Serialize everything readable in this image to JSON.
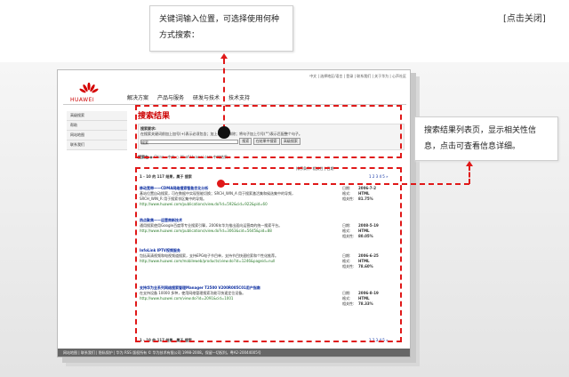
{
  "close_label": "[点击关闭]",
  "callouts": {
    "input": "关键词输入位置，可选择使用何种方式搜索：",
    "results": "搜索结果列表页，显示相关性信息，点击可查看信息详细。"
  },
  "brand": "HUAWEI",
  "toplinks": "中文 | 选择地区/语言 | 登录 | 联系我们 | 关于华为 | 心声社区",
  "nav": [
    "解决方案",
    "产品与服务",
    "研发与技术",
    "技术支持"
  ],
  "sidebar": [
    "高级搜索",
    "帮助",
    "网站地图",
    "联系我们"
  ],
  "page_title": "搜索结果",
  "search": {
    "label": "搜索要求:",
    "hint": "在搜索关键词前加上加号(+)表示必须包含；加上(-)表示排除；将句子加上引号(\"\")表示匹配整个句子。",
    "value": "搜索",
    "btn_search": "搜索",
    "btn_within": "在结果中搜索",
    "btn_advanced": "高级搜索",
    "scope_label": "搜索在",
    "scope_a": "China - 中文",
    "scope_b": "All of Huawei.com 中的结果"
  },
  "sort_text": "排序条件: 相关性 | 日期",
  "count_text": "1 - 10 的 117 结果，属于 搜索",
  "pages_text": "1 2 3 4 5 »",
  "results": [
    {
      "title": "移动宽带——CDMA网络搜索智能优化分析",
      "desc": "基站位置自动搜索，可在数据中实现智能切换；SRCH_WIN_A 用于搜索激活集和候选集中的导频，SRCH_WIN_R 用于搜索邻区集中的导频。",
      "url": "http://www.huawei.com/publications/view.do?id=592&cid=922&pid=60",
      "date": "2006-7-2",
      "format": "HTML",
      "rel": "81.75%"
    },
    {
      "title": "热点聚焦——运营商新技术",
      "desc": "通用搜索使用Google百度等专业搜索引擎，2006年华为推出面向运营商的统一搜索平台。",
      "url": "http://www.huawei.com/publications/view.do?id=3063&cid=5645&pid=88",
      "date": "2008-5-19",
      "format": "HTML",
      "rel": "80.05%"
    },
    {
      "title": "InfoLink IPTV视频服务",
      "desc": "包括高清视频和电视频道搜索，支持EPG电子节目单，支持节目快速检索和个性化推荐。",
      "url": "http://www.huawei.com/mobileweb/products/view.do?id=1246&pageid=null",
      "date": "2006-6-25",
      "format": "HTML",
      "rel": "78.60%"
    },
    {
      "title": "支持华为全系列网络搜索管理Manager T2500 V200R005C01用户指南",
      "desc": "在支持设备 10000 多种，使用网络管理搜索功能可快速定位设备。",
      "url": "http://www.huawei.com/view.do?id=2091&cid=1001",
      "date": "2006-8-19",
      "format": "HTML",
      "rel": "78.33%"
    }
  ],
  "meta_labels": {
    "date": "日期:",
    "format": "格式:",
    "rel": "相关性:"
  },
  "footer": "网站地图 | 联系我们 | 隐私保护 | 华为 RSS     版权所有 © 华为技术有限公司 1998-2008。保留一切权利。粤A2-20044005号"
}
